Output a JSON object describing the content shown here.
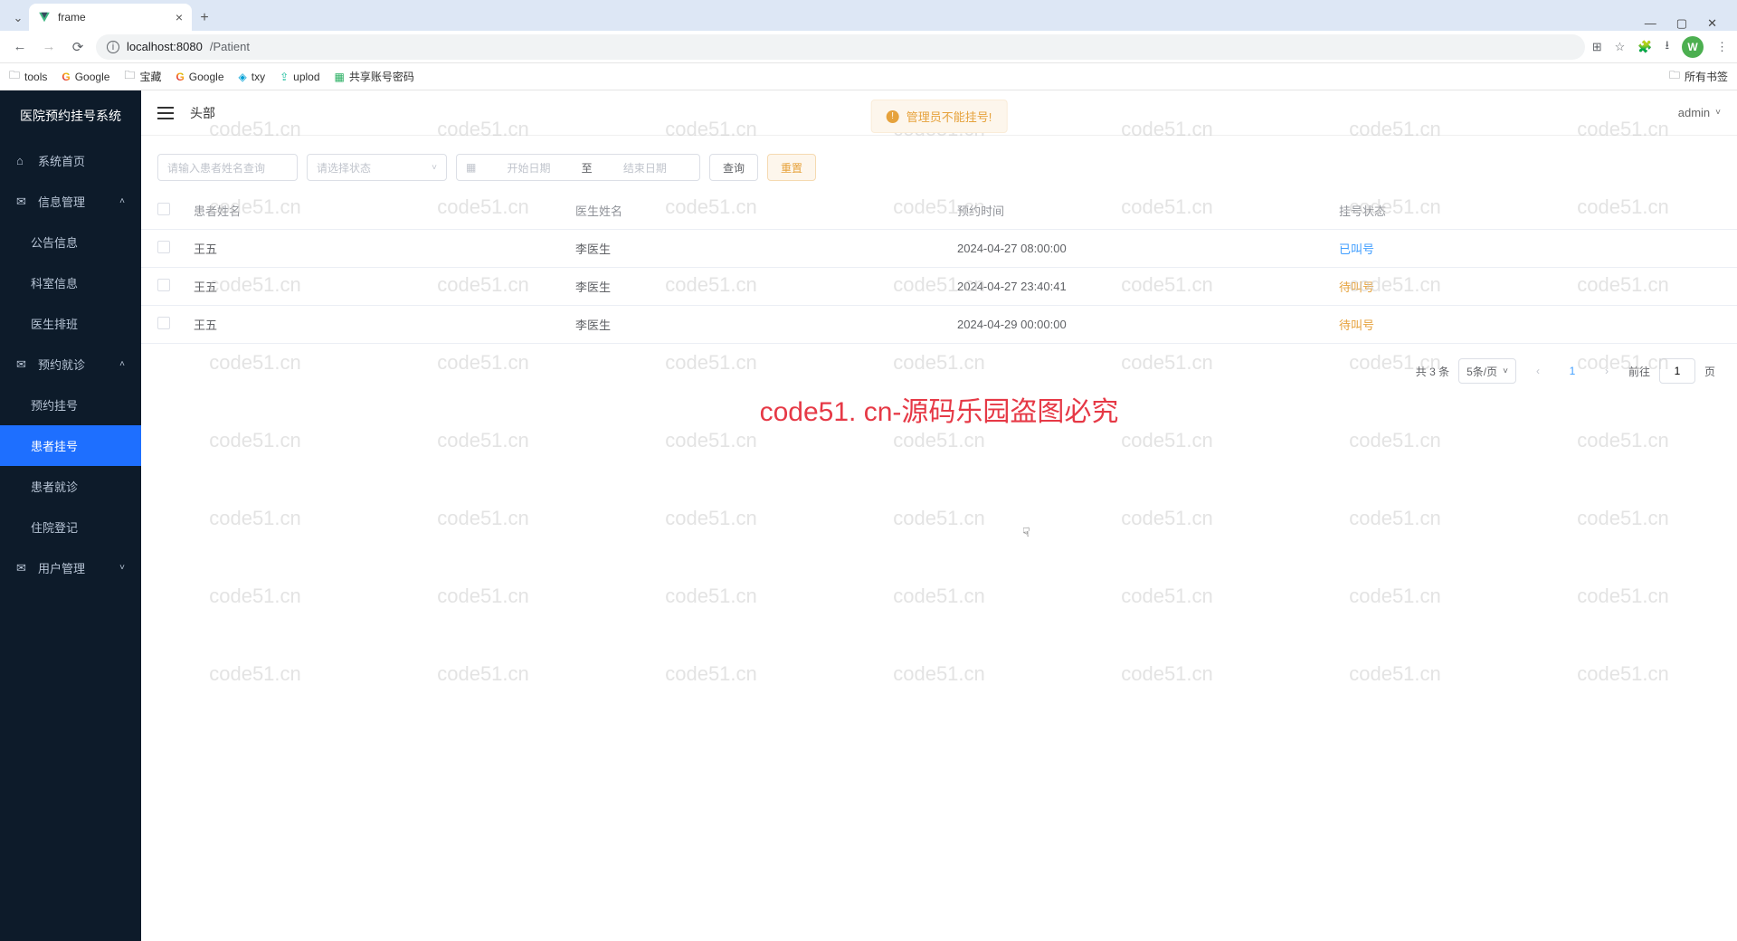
{
  "browser": {
    "tab_title": "frame",
    "url_host": "localhost:8080",
    "url_path": "/Patient",
    "avatar_letter": "W",
    "bookmarks": [
      "tools",
      "Google",
      "宝藏",
      "Google",
      "txy",
      "uplod",
      "共享账号密码"
    ],
    "all_bookmarks": "所有书签"
  },
  "sidebar": {
    "title": "医院预约挂号系统",
    "home": "系统首页",
    "info_mgmt": "信息管理",
    "announcement": "公告信息",
    "department": "科室信息",
    "doctor_schedule": "医生排班",
    "appointment": "预约就诊",
    "register": "预约挂号",
    "patient_register": "患者挂号",
    "patient_treatment": "患者就诊",
    "inpatient": "住院登记",
    "user_mgmt": "用户管理"
  },
  "topbar": {
    "breadcrumb": "头部",
    "user": "admin"
  },
  "notice": "管理员不能挂号!",
  "search": {
    "name_placeholder": "请输入患者姓名查询",
    "status_placeholder": "请选择状态",
    "start_date": "开始日期",
    "date_sep": "至",
    "end_date": "结束日期",
    "query_btn": "查询",
    "reset_btn": "重置"
  },
  "table": {
    "headers": {
      "patient": "患者姓名",
      "doctor": "医生姓名",
      "time": "预约时间",
      "status": "挂号状态"
    },
    "rows": [
      {
        "patient": "王五",
        "doctor": "李医生",
        "time": "2024-04-27 08:00:00",
        "status": "已叫号",
        "status_class": "status-called"
      },
      {
        "patient": "王五",
        "doctor": "李医生",
        "time": "2024-04-27 23:40:41",
        "status": "待叫号",
        "status_class": "status-waiting"
      },
      {
        "patient": "王五",
        "doctor": "李医生",
        "time": "2024-04-29 00:00:00",
        "status": "待叫号",
        "status_class": "status-waiting"
      }
    ]
  },
  "pagination": {
    "total": "共 3 条",
    "page_size": "5条/页",
    "current": "1",
    "goto_prefix": "前往",
    "goto_value": "1",
    "goto_suffix": "页"
  },
  "watermark": "code51.cn",
  "big_watermark": "code51. cn-源码乐园盗图必究"
}
